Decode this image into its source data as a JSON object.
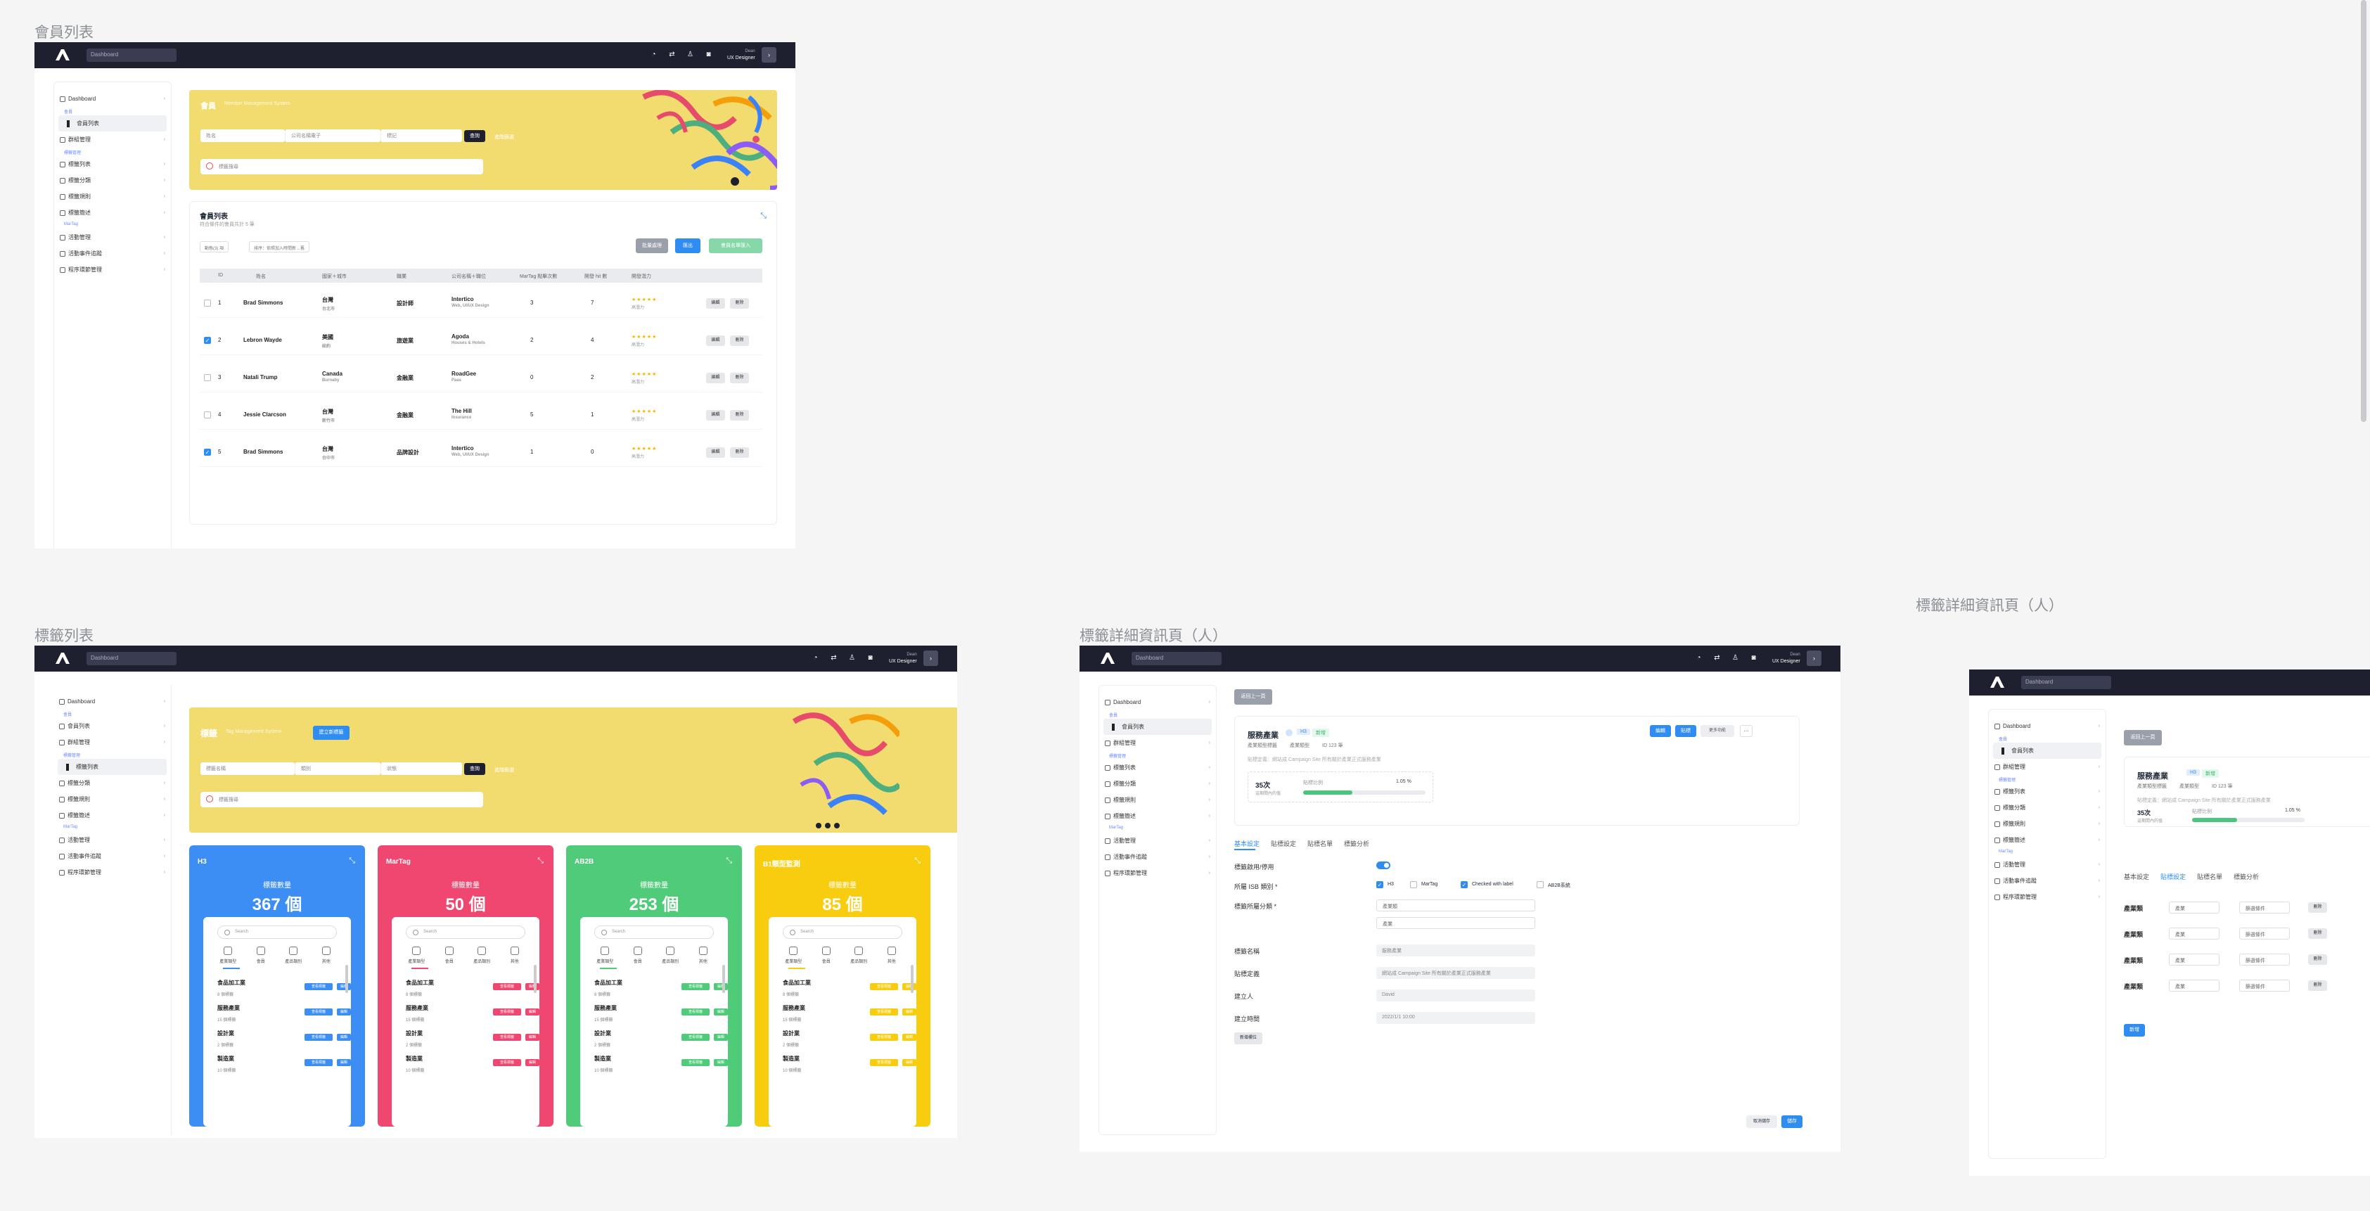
{
  "frames": {
    "member_list_label": "會員列表",
    "tag_list_label": "標籤列表",
    "tag_detail_label": "標籤詳細資訊頁（人）",
    "tag_detail2_label": "標籤詳細資訊頁（人）"
  },
  "topbar": {
    "search": "Dashboard",
    "user_role": "Dean",
    "user_title": "UX Designer",
    "user_role2": "Dean",
    "user_title2": "UX Designer"
  },
  "sidebar": {
    "dashboard": "Dashboard",
    "sec_member": "會員",
    "member_list": "會員列表",
    "member_mgmt": "群組管理",
    "sec_tag": "標籤管理",
    "tag_list": "標籤列表",
    "tag_class": "標籤分類",
    "tag_rule": "標籤規則",
    "tag_setting": "標籤簡述",
    "sec_martag": "MarTag",
    "m1": "活動管理",
    "m2": "活動事件追蹤",
    "m3": "程序環節管理"
  },
  "member_page": {
    "hero_title": "會員",
    "hero_sub": "Member Management System",
    "f1": "姓名",
    "f2": "公司名稱電子",
    "f3": "標記",
    "search_btn": "查詢",
    "advanced": "進階篩選",
    "tag_search": "標籤搜尋",
    "list_title": "會員列表",
    "list_sub": "符合條件的會員共計 5 筆",
    "filter1": "動態(3) 項",
    "filter2": "排序：依照加入時間新→舊",
    "btn_batch": "批量處理",
    "btn_export": "匯出",
    "btn_import": "會員名單匯入",
    "headers": [
      "ID",
      "姓名",
      "國家＋城市",
      "職業",
      "公司名稱＋職位",
      "MarTag 點擊次數",
      "開發 hit 數",
      "開發潛力"
    ],
    "rows": [
      {
        "id": "1",
        "name": "Brad Simmons",
        "country": "台灣",
        "city": "台北市",
        "job": "設計師",
        "company": "Intertico",
        "pos": "Web, UI/UX Design",
        "clicks": "3",
        "hits": "7",
        "level": "高潛力",
        "checked": false
      },
      {
        "id": "2",
        "name": "Lebron Wayde",
        "country": "美國",
        "city": "紐約",
        "job": "旅遊業",
        "company": "Agoda",
        "pos": "Houses & Hotels",
        "clicks": "2",
        "hits": "4",
        "level": "高潛力",
        "checked": true
      },
      {
        "id": "3",
        "name": "Natali Trump",
        "country": "Canada",
        "city": "Burnaby",
        "job": "金融業",
        "company": "RoadGee",
        "pos": "Paas",
        "clicks": "0",
        "hits": "2",
        "level": "高潛力",
        "checked": false
      },
      {
        "id": "4",
        "name": "Jessie Clarcson",
        "country": "台灣",
        "city": "新竹市",
        "job": "金融業",
        "company": "The Hill",
        "pos": "Insurance",
        "clicks": "5",
        "hits": "1",
        "level": "高潛力",
        "checked": false
      },
      {
        "id": "5",
        "name": "Brad Simmons",
        "country": "台灣",
        "city": "台中市",
        "job": "品牌設計",
        "company": "Intertico",
        "pos": "Web, UI/UX Design",
        "clicks": "1",
        "hits": "0",
        "level": "高潛力",
        "checked": true
      }
    ],
    "edit": "編輯",
    "delete": "刪除"
  },
  "tag_page": {
    "hero_title": "標籤",
    "hero_sub": "Tag Management System",
    "add_btn": "建立新標籤",
    "f1": "標籤名稱",
    "f2": "類別",
    "f3": "狀態",
    "search_btn": "查詢",
    "advanced": "進階篩選",
    "tag_search": "標籤搜尋",
    "count_label": "標籤數量",
    "search_ph": "Search",
    "tabs": [
      "產業類型",
      "會員",
      "產品類別",
      "其他"
    ],
    "cards": [
      {
        "title": "H3",
        "count": "367 個",
        "color": "#3c8ef5"
      },
      {
        "title": "MarTag",
        "count": "50 個",
        "color": "#ef476f"
      },
      {
        "title": "AB2B",
        "count": "253 個",
        "color": "#4fcb7a"
      },
      {
        "title": "B1類型監測",
        "count": "85 個",
        "color": "#f9cd0f"
      }
    ],
    "rows": [
      {
        "name": "食品加工業",
        "sub": "8 個標籤"
      },
      {
        "name": "服務產業",
        "sub": "15 個標籤"
      },
      {
        "name": "設計業",
        "sub": "2 個標籤"
      },
      {
        "name": "製造業",
        "sub": "10 個標籤"
      }
    ],
    "badge1": "查看標籤",
    "badge2": "編輯"
  },
  "detail_page": {
    "back": "返回上一頁",
    "name": "服務產業",
    "chip1": "H3",
    "chip2": "新增",
    "meta1": "產業類型標籤",
    "meta2": "產業類型",
    "meta3": "ID 123 筆",
    "desc": "貼標定義：網站成 Campaign Site 所有關於產業正式服務產業",
    "count_big": "35次",
    "count_sub": "這期間內的值",
    "ratio_label": "貼標比例",
    "ratio": "1.05 %",
    "ratio_value": 0.4,
    "btn_edit": "編輯",
    "btn_copy": "貼標",
    "btn_more": "更多功能",
    "tabs": [
      "基本設定",
      "貼標設定",
      "貼標名單",
      "標籤分析"
    ],
    "l_enable": "標籤啟用/停用",
    "l_group": "所屬 ISB 類別 *",
    "l_sort": "標籤所屬分類 *",
    "opt1": "H3",
    "opt2": "MarTag",
    "opt3": "Checked with label",
    "opt4": "AB2B系統",
    "sel1": "產業類",
    "sel2": "產業",
    "l_name": "標籤名稱",
    "v_name": "服務產業",
    "l_def": "貼標定義",
    "v_def": "網站成 Campaign Site 所有關於產業正式服務產業",
    "l_creator": "建立人",
    "v_creator": "David",
    "l_time": "建立時間",
    "v_time": "2022/1/1 10:00",
    "add_btn": "新增欄位",
    "cancel": "取消儲存",
    "save": "儲存"
  },
  "detail2_page": {
    "row_label": "產業類",
    "s1": "產業",
    "s2": "篩選條件",
    "del": "刪除",
    "add": "新增"
  }
}
